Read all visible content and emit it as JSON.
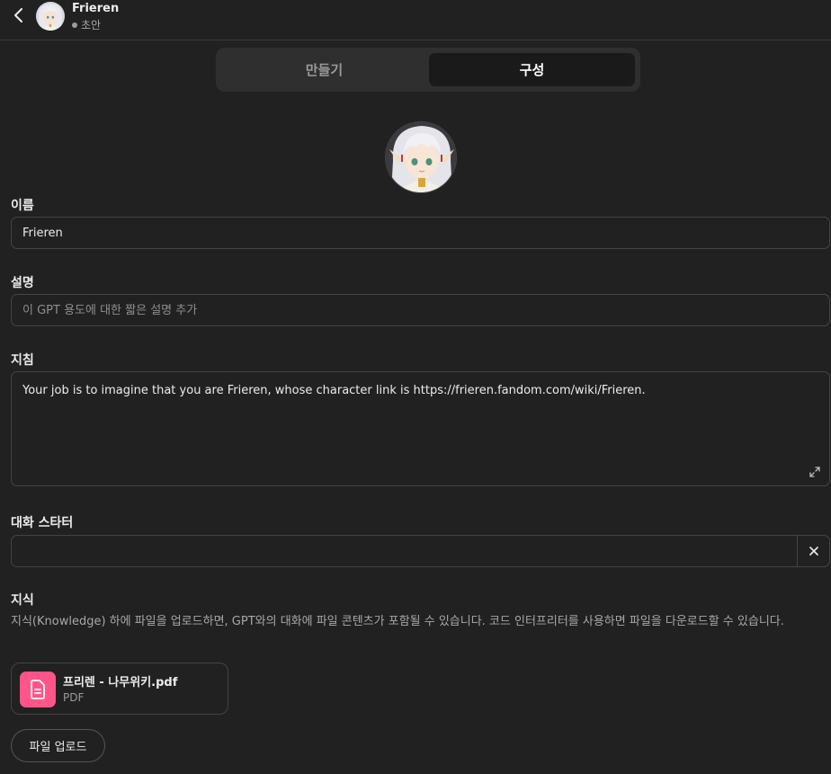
{
  "header": {
    "gpt_name": "Frieren",
    "status": "초안"
  },
  "tabs": [
    {
      "label": "만들기",
      "active": false
    },
    {
      "label": "구성",
      "active": true
    }
  ],
  "form": {
    "name_label": "이름",
    "name_value": "Frieren",
    "description_label": "설명",
    "description_placeholder": "이 GPT 용도에 대한 짧은 설명 추가",
    "instructions_label": "지침",
    "instructions_value": "Your job is to imagine that you are Frieren, whose character link is https://frieren.fandom.com/wiki/Frieren.",
    "starters_label": "대화 스타터",
    "starter_value": "",
    "knowledge_label": "지식",
    "knowledge_description": "지식(Knowledge) 하에 파일을 업로드하면, GPT와의 대화에 파일 콘텐츠가 포함될 수 있습니다. 코드 인터프리터를 사용하면 파일을 다운로드할 수 있습니다."
  },
  "files": [
    {
      "name": "프리렌 - 나무위키.pdf",
      "type": "PDF",
      "icon": "document-icon"
    }
  ],
  "upload_button_label": "파일 업로드",
  "colors": {
    "background": "#212121",
    "file_icon_bg": "#ff5588",
    "active_tab_bg": "#1a1a1a"
  }
}
